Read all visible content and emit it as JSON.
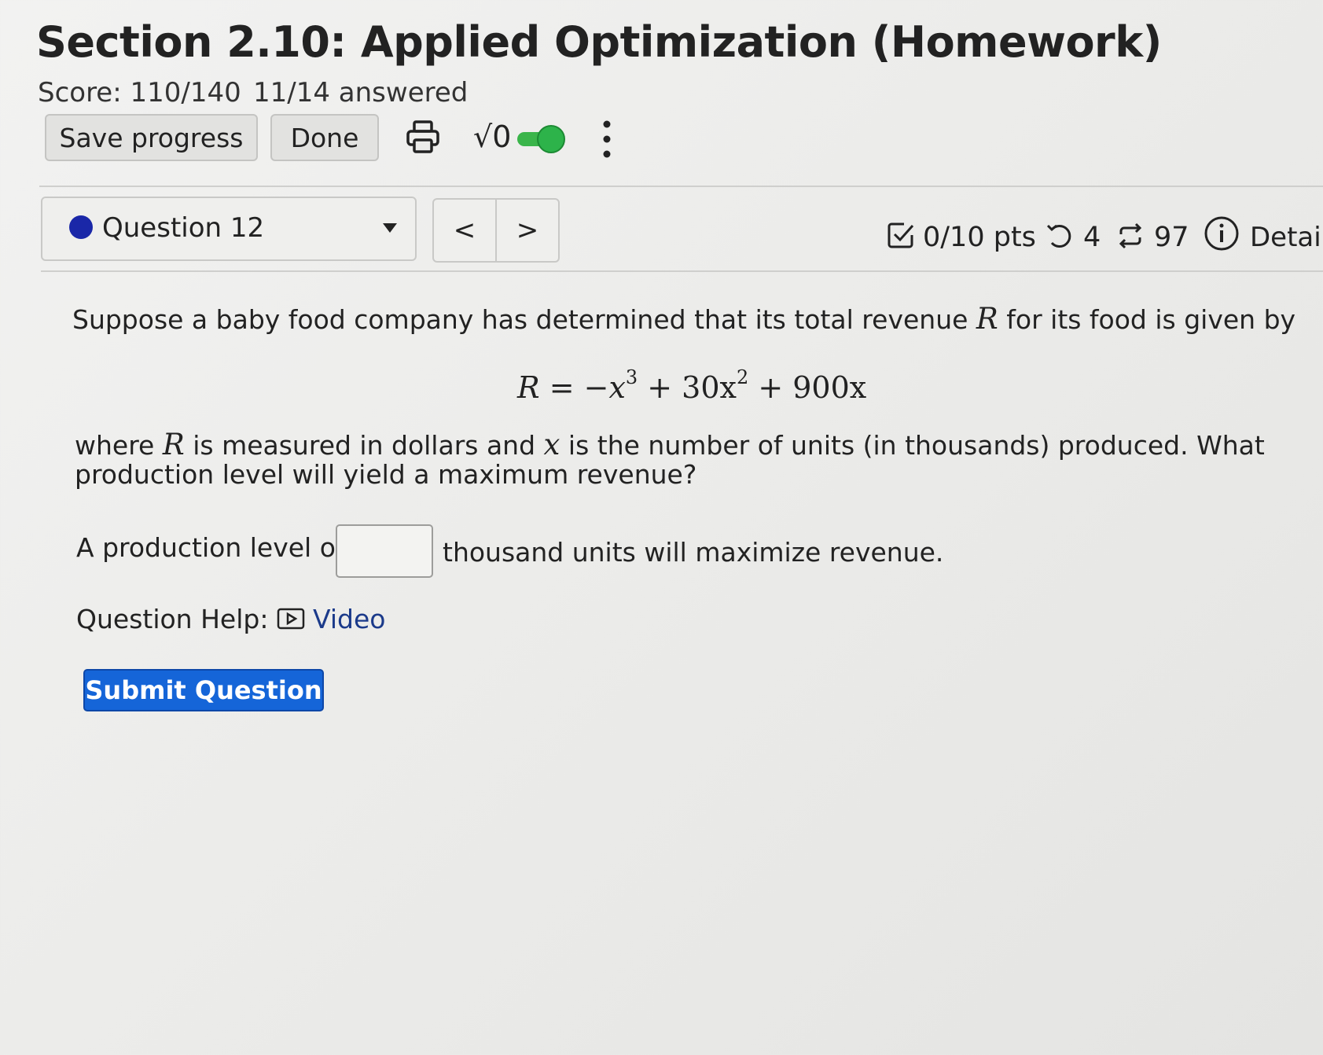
{
  "header": {
    "title": "Section 2.10: Applied Optimization (Homework)",
    "score": "Score: 110/140",
    "answered": "11/14 answered"
  },
  "toolbar": {
    "save_label": "Save progress",
    "done_label": "Done",
    "math_label": "√0",
    "print_icon": "printer-icon",
    "toggle_state": "on",
    "toggle_color": "#2db34a",
    "more_icon": "kebab-menu-icon"
  },
  "question_nav": {
    "selected": "Question 12",
    "status_color": "#1a27a8",
    "prev_label": "<",
    "next_label": ">"
  },
  "meta": {
    "points": "0/10 pts",
    "retries": "4",
    "attempts": "97",
    "details_label": "Detail"
  },
  "question": {
    "prompt_line1_pre": "Suppose a baby food company has determined that its total revenue",
    "prompt_line1_post": "for its food is given by",
    "var_R": "R",
    "var_x": "x",
    "formula_pre": "R = −x",
    "exp3": "3",
    "formula_mid": " + 30x",
    "exp2": "2",
    "formula_post": " + 900x",
    "prompt_line2_pre": "where",
    "prompt_line2_mid": "is measured in dollars and",
    "prompt_line2_post": "is the number of units (in thousands) produced. What",
    "prompt_line3": "production level will yield a maximum revenue?",
    "answer_pre": "A production level of",
    "answer_value": "",
    "answer_post": "thousand units will maximize revenue.",
    "help_label": "Question Help:",
    "video_label": "Video",
    "submit_label": "Submit Question"
  }
}
